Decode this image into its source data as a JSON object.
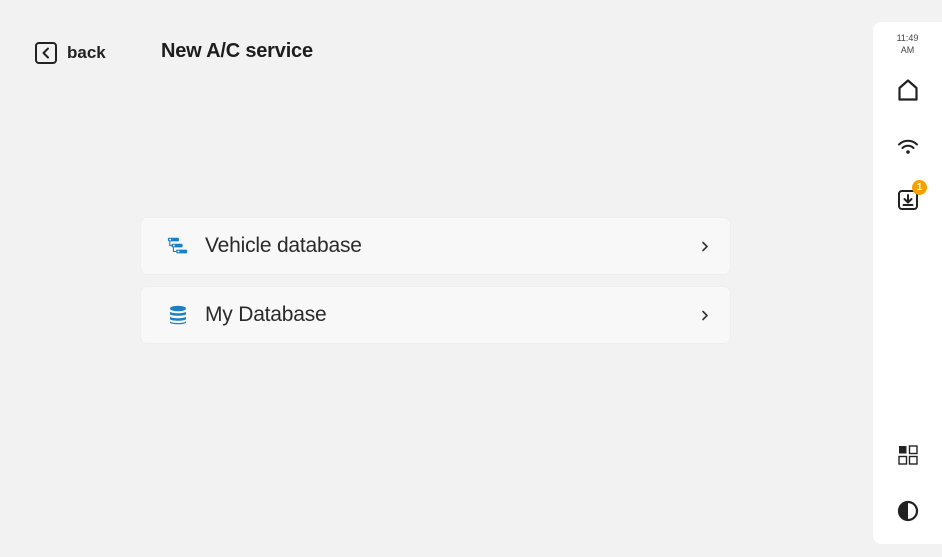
{
  "header": {
    "back_label": "back",
    "title": "New A/C service"
  },
  "menu": {
    "items": [
      {
        "label": "Vehicle database",
        "icon": "vehicle-database-icon"
      },
      {
        "label": "My Database",
        "icon": "my-database-icon"
      }
    ]
  },
  "sidebar": {
    "time": "11:49",
    "ampm": "AM",
    "downloads_badge": "1",
    "icons": [
      "home-icon",
      "wifi-icon",
      "download-icon",
      "apps-grid-icon",
      "contrast-icon"
    ]
  },
  "colors": {
    "background": "#f2f2f2",
    "accent_blue": "#1e7fc0",
    "badge_orange": "#f5a200"
  }
}
